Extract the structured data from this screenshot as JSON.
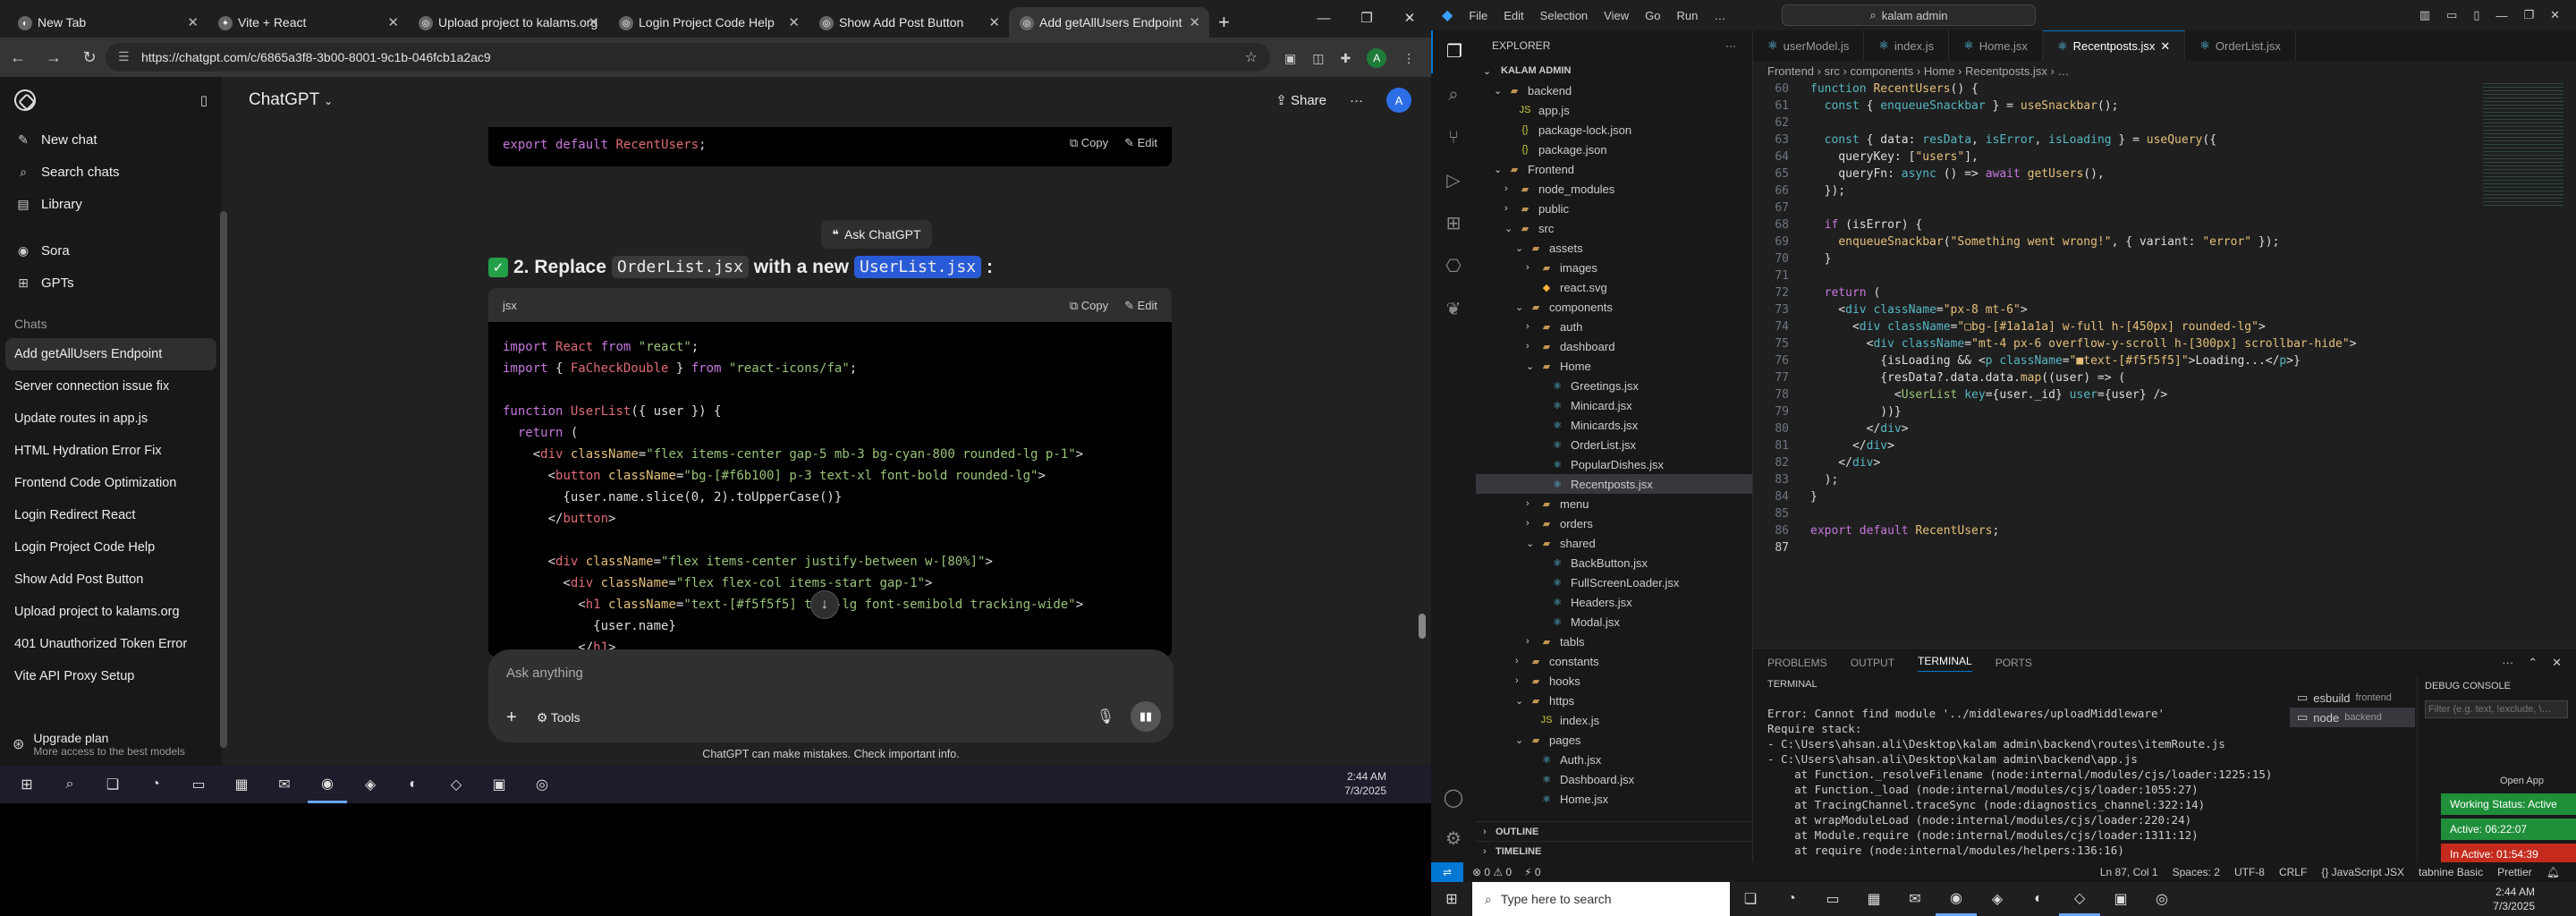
{
  "chrome": {
    "tabs": [
      {
        "label": "New Tab",
        "fav": "◐",
        "active": false
      },
      {
        "label": "Vite + React",
        "fav": "✦",
        "active": false
      },
      {
        "label": "Upload project to kalams.org",
        "fav": "◎",
        "active": false
      },
      {
        "label": "Login Project Code Help",
        "fav": "◎",
        "active": false
      },
      {
        "label": "Show Add Post Button",
        "fav": "◎",
        "active": false
      },
      {
        "label": "Add getAllUsers Endpoint",
        "fav": "◎",
        "active": true
      }
    ],
    "url": "https://chatgpt.com/c/6865a3f8-3b00-8001-9c1b-046fcb1a2ac9",
    "profile_initial": "A"
  },
  "chatgpt": {
    "sidebar": {
      "new_chat": "New chat",
      "search_chats": "Search chats",
      "library": "Library",
      "sora": "Sora",
      "gpts": "GPTs",
      "chats_heading": "Chats",
      "chats": [
        "Add getAllUsers Endpoint",
        "Server connection issue fix",
        "Update routes in app.js",
        "HTML Hydration Error Fix",
        "Frontend Code Optimization",
        "Login Redirect React",
        "Login Project Code Help",
        "Show Add Post Button",
        "Upload project to kalams.org",
        "401 Unauthorized Token Error",
        "Vite API Proxy Setup"
      ],
      "upgrade_title": "Upgrade plan",
      "upgrade_sub": "More access to the best models"
    },
    "header": {
      "title": "ChatGPT",
      "share": "Share",
      "avatar": "A"
    },
    "prev_code": {
      "kw": "export default",
      "name": "RecentUsers",
      "end": ";"
    },
    "copy": "Copy",
    "edit": "Edit",
    "ask": "Ask ChatGPT",
    "heading": {
      "num": "2. Replace",
      "old": "OrderList.jsx",
      "mid": "with a new",
      "new": "UserList.jsx",
      "end": ":"
    },
    "lang": "jsx",
    "composer_placeholder": "Ask anything",
    "tools": "Tools",
    "disclaimer": "ChatGPT can make mistakes. Check important info."
  },
  "taskbar1": {
    "time": "2:44 AM",
    "date": "7/3/2025"
  },
  "vscode": {
    "menu": [
      "File",
      "Edit",
      "Selection",
      "View",
      "Go",
      "Run",
      "…"
    ],
    "search": "kalam admin",
    "explorer_title": "EXPLORER",
    "tree": [
      {
        "label": "KALAM ADMIN",
        "depth": 0,
        "type": "root",
        "open": true
      },
      {
        "label": "backend",
        "depth": 1,
        "type": "folder",
        "open": true
      },
      {
        "label": "app.js",
        "depth": 2,
        "type": "js"
      },
      {
        "label": "package-lock.json",
        "depth": 2,
        "type": "json"
      },
      {
        "label": "package.json",
        "depth": 2,
        "type": "json"
      },
      {
        "label": "Frontend",
        "depth": 1,
        "type": "folder",
        "open": true
      },
      {
        "label": "node_modules",
        "depth": 2,
        "type": "folder",
        "open": false
      },
      {
        "label": "public",
        "depth": 2,
        "type": "folder",
        "open": false
      },
      {
        "label": "src",
        "depth": 2,
        "type": "folder",
        "open": true
      },
      {
        "label": "assets",
        "depth": 3,
        "type": "folder",
        "open": true
      },
      {
        "label": "images",
        "depth": 4,
        "type": "folder",
        "open": false
      },
      {
        "label": "react.svg",
        "depth": 4,
        "type": "svg"
      },
      {
        "label": "components",
        "depth": 3,
        "type": "folder",
        "open": true
      },
      {
        "label": "auth",
        "depth": 4,
        "type": "folder",
        "open": false
      },
      {
        "label": "dashboard",
        "depth": 4,
        "type": "folder",
        "open": false
      },
      {
        "label": "Home",
        "depth": 4,
        "type": "folder",
        "open": true
      },
      {
        "label": "Greetings.jsx",
        "depth": 5,
        "type": "jsx"
      },
      {
        "label": "Minicard.jsx",
        "depth": 5,
        "type": "jsx"
      },
      {
        "label": "Minicards.jsx",
        "depth": 5,
        "type": "jsx"
      },
      {
        "label": "OrderList.jsx",
        "depth": 5,
        "type": "jsx"
      },
      {
        "label": "PopularDishes.jsx",
        "depth": 5,
        "type": "jsx"
      },
      {
        "label": "Recentposts.jsx",
        "depth": 5,
        "type": "jsx",
        "selected": true
      },
      {
        "label": "menu",
        "depth": 4,
        "type": "folder",
        "open": false
      },
      {
        "label": "orders",
        "depth": 4,
        "type": "folder",
        "open": false
      },
      {
        "label": "shared",
        "depth": 4,
        "type": "folder",
        "open": true
      },
      {
        "label": "BackButton.jsx",
        "depth": 5,
        "type": "jsx"
      },
      {
        "label": "FullScreenLoader.jsx",
        "depth": 5,
        "type": "jsx"
      },
      {
        "label": "Headers.jsx",
        "depth": 5,
        "type": "jsx"
      },
      {
        "label": "Modal.jsx",
        "depth": 5,
        "type": "jsx"
      },
      {
        "label": "tabls",
        "depth": 4,
        "type": "folder",
        "open": false
      },
      {
        "label": "constants",
        "depth": 3,
        "type": "folder",
        "open": false
      },
      {
        "label": "hooks",
        "depth": 3,
        "type": "folder",
        "open": false
      },
      {
        "label": "https",
        "depth": 3,
        "type": "folder",
        "open": true
      },
      {
        "label": "index.js",
        "depth": 4,
        "type": "js"
      },
      {
        "label": "pages",
        "depth": 3,
        "type": "folder",
        "open": true
      },
      {
        "label": "Auth.jsx",
        "depth": 4,
        "type": "jsx"
      },
      {
        "label": "Dashboard.jsx",
        "depth": 4,
        "type": "jsx"
      },
      {
        "label": "Home.jsx",
        "depth": 4,
        "type": "jsx"
      }
    ],
    "outline": "OUTLINE",
    "timeline": "TIMELINE",
    "editor_tabs": [
      {
        "label": "userModel.js",
        "active": false
      },
      {
        "label": "index.js",
        "active": false
      },
      {
        "label": "Home.jsx",
        "active": false
      },
      {
        "label": "Recentposts.jsx",
        "active": true
      },
      {
        "label": "OrderList.jsx",
        "active": false
      }
    ],
    "breadcrumb": "Frontend › src › components › Home › Recentposts.jsx › …",
    "panel_tabs": [
      "PROBLEMS",
      "OUTPUT",
      "TERMINAL",
      "PORTS"
    ],
    "terminal_label": "TERMINAL",
    "terminal_lines": [
      "Error: Cannot find module '../middlewares/uploadMiddleware'",
      "Require stack:",
      "- C:\\Users\\ahsan.ali\\Desktop\\kalam admin\\backend\\routes\\itemRoute.js",
      "- C:\\Users\\ahsan.ali\\Desktop\\kalam admin\\backend\\app.js",
      "    at Function._resolveFilename (node:internal/modules/cjs/loader:1225:15)",
      "    at Function._load (node:internal/modules/cjs/loader:1055:27)",
      "    at TracingChannel.traceSync (node:diagnostics_channel:322:14)",
      "    at wrapModuleLoad (node:internal/modules/cjs/loader:220:24)",
      "    at Module.require (node:internal/modules/cjs/loader:1311:12)",
      "    at require (node:internal/modules/helpers:136:16)"
    ],
    "terminals": [
      {
        "name": "esbuild",
        "tag": "frontend"
      },
      {
        "name": "node",
        "tag": "backend"
      }
    ],
    "debug_title": "DEBUG CONSOLE",
    "debug_filter": "Filter (e.g. text, !exclude, \\…",
    "open_app": "Open App",
    "working_status": "Working Status: Active",
    "active_time": "Active: 06:22:07",
    "inactive_time": "In Active: 01:54:39",
    "status": {
      "errors": "⊗ 0 ⚠ 0",
      "ports": "⚡ 0",
      "pos": "Ln 87, Col 1",
      "spaces": "Spaces: 2",
      "enc": "UTF-8",
      "eol": "CRLF",
      "lang": "{} JavaScript JSX",
      "ext": "tabnine Basic",
      "prettier": "Prettier"
    },
    "taskbar_search": "Type here to search",
    "time": "2:44 AM",
    "date": "7/3/2025"
  },
  "colors": {
    "accent": "#0078d4",
    "green": "#24a148",
    "highlight": "#2a5bd7",
    "status_green": "#1f8f3a",
    "status_red": "#c42b1c"
  }
}
